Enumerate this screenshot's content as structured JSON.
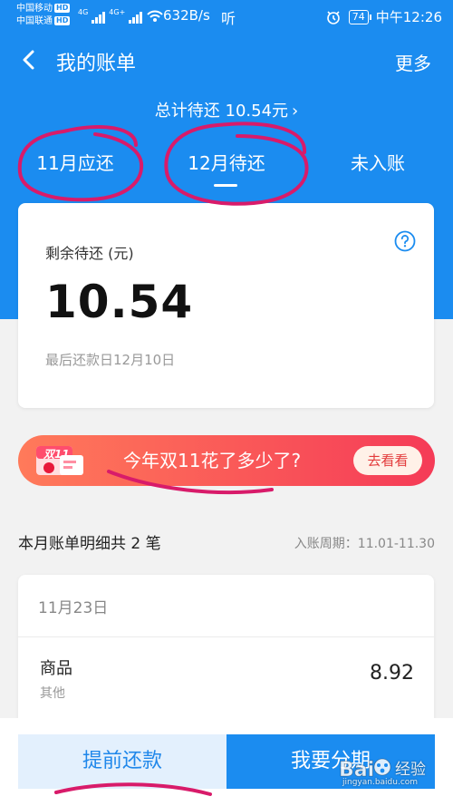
{
  "status_bar": {
    "carrier_1": "中国移动",
    "carrier_2": "中国联通",
    "hd_1": "HD",
    "hd_2": "HD",
    "net_1": "4G",
    "net_2": "4G+",
    "speed": "632B/s",
    "hd_voice": "听",
    "battery": "74",
    "time": "中午12:26"
  },
  "nav": {
    "title": "我的账单",
    "more_label": "更多"
  },
  "summary": {
    "total_label": "总计待还 10.54元",
    "chevron": "›"
  },
  "tabs": [
    {
      "label": "11月应还",
      "selected": false
    },
    {
      "label": "12月待还",
      "selected": true
    },
    {
      "label": "未入账",
      "selected": false
    }
  ],
  "bill_card": {
    "remaining_label": "剩余待还 (元)",
    "amount": "10.54",
    "due_text": "最后还款日12月10日"
  },
  "banner": {
    "badge_text": "双11",
    "text": "今年双11花了多少了?",
    "button_label": "去看看"
  },
  "detail": {
    "title": "本月账单明细共 2 笔",
    "period": "入账周期：11.01-11.30"
  },
  "transactions": [
    {
      "date": "11月23日",
      "name": "商品",
      "category": "其他",
      "amount": "8.92"
    }
  ],
  "bottom": {
    "prepay_label": "提前还款",
    "installment_label": "我要分期"
  },
  "watermark": {
    "text": "Bai",
    "text2": "经验",
    "url": "jingyan.baidu.com"
  },
  "colors": {
    "primary_blue": "#1b8cf0",
    "annotation_pink": "#d81b6a",
    "banner_red": "#f53b57",
    "prepay_bg": "#e3f0fd"
  }
}
